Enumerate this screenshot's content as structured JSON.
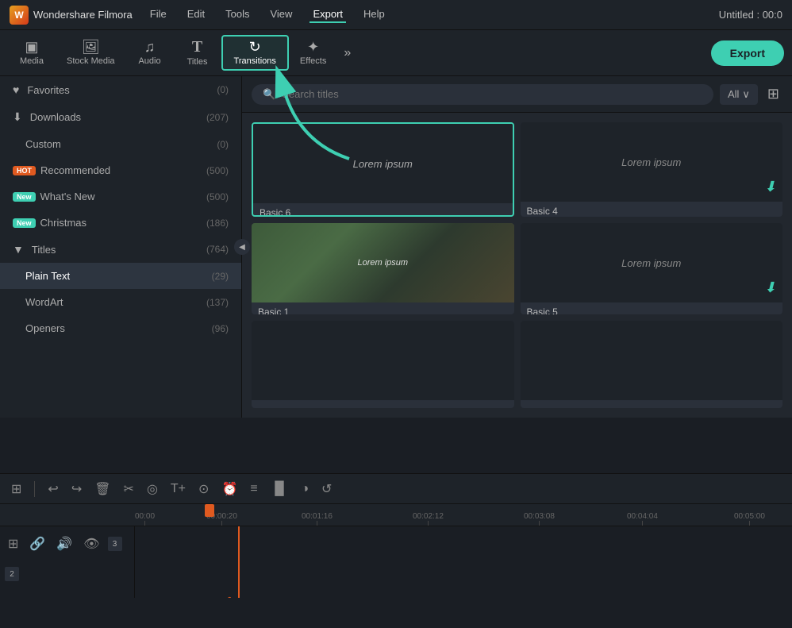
{
  "app": {
    "name": "Wondershare Filmora",
    "title": "Untitled : 00:0"
  },
  "menu": {
    "items": [
      "File",
      "Edit",
      "Tools",
      "View",
      "Export",
      "Help"
    ],
    "active": "Export"
  },
  "toolbar": {
    "items": [
      {
        "id": "media",
        "label": "Media",
        "icon": "▣"
      },
      {
        "id": "stock-media",
        "label": "Stock Media",
        "icon": "🖼"
      },
      {
        "id": "audio",
        "label": "Audio",
        "icon": "♫"
      },
      {
        "id": "titles",
        "label": "Titles",
        "icon": "T"
      },
      {
        "id": "transitions",
        "label": "Transitions",
        "icon": "↻"
      },
      {
        "id": "effects",
        "label": "Effects",
        "icon": "✦"
      }
    ],
    "active": "transitions",
    "export_label": "Export",
    "more_icon": "»"
  },
  "sidebar": {
    "items": [
      {
        "id": "favorites",
        "label": "Favorites",
        "icon": "♥",
        "count": "(0)"
      },
      {
        "id": "downloads",
        "label": "Downloads",
        "icon": "⬇",
        "count": "(207)"
      },
      {
        "id": "custom",
        "label": "Custom",
        "icon": "",
        "count": "(0)",
        "indent": true
      },
      {
        "id": "recommended",
        "label": "Recommended",
        "icon": "",
        "badge": "HOT",
        "badge_type": "hot",
        "count": "(500)"
      },
      {
        "id": "whats-new",
        "label": "What's New",
        "icon": "",
        "badge": "New",
        "badge_type": "new",
        "count": "(500)"
      },
      {
        "id": "christmas",
        "label": "Christmas",
        "icon": "",
        "badge": "New",
        "badge_type": "new",
        "count": "(186)"
      },
      {
        "id": "titles",
        "label": "Titles",
        "icon": "▶",
        "count": "(764)",
        "expand": true
      },
      {
        "id": "plain-text",
        "label": "Plain Text",
        "icon": "",
        "count": "(29)",
        "indent": true,
        "selected": true
      },
      {
        "id": "wordart",
        "label": "WordArt",
        "icon": "",
        "count": "(137)",
        "indent": true
      },
      {
        "id": "openers",
        "label": "Openers",
        "icon": "",
        "count": "(96)",
        "indent": true
      }
    ]
  },
  "panel": {
    "search_placeholder": "Search titles",
    "filter_label": "All",
    "cards": [
      {
        "id": "basic6",
        "label": "Basic 6",
        "text": "Lorem ipsum",
        "selected": true,
        "has_download": false
      },
      {
        "id": "basic4",
        "label": "Basic 4",
        "text": "Lorem ipsum",
        "selected": false,
        "has_download": true
      },
      {
        "id": "basic1",
        "label": "Basic 1",
        "text": "Lorem ipsum",
        "selected": false,
        "has_download": false,
        "has_photo": true
      },
      {
        "id": "basic5",
        "label": "Basic 5",
        "text": "Lorem ipsum",
        "selected": false,
        "has_download": true
      },
      {
        "id": "card5",
        "label": "",
        "text": "",
        "selected": false,
        "has_download": false
      },
      {
        "id": "card6",
        "label": "",
        "text": "",
        "selected": false,
        "has_download": false
      }
    ]
  },
  "timeline": {
    "toolbar_icons": [
      "⊞",
      "↩",
      "↪",
      "🗑",
      "✂",
      "◎",
      "T+",
      "⊙",
      "⏰",
      "≡",
      "▐▌",
      "◑",
      "↺"
    ],
    "ruler_marks": [
      "00:00",
      "00:00:20",
      "00:01:16",
      "00:02:12",
      "00:03:08",
      "00:04:04",
      "00:05:00"
    ],
    "tracks": [
      {
        "number": "3",
        "icons": [
          "⊞",
          "🔗",
          "🔊",
          "👁"
        ]
      },
      {
        "number": "2",
        "icons": []
      }
    ]
  },
  "arrow": {
    "color": "#3ecfb2"
  }
}
